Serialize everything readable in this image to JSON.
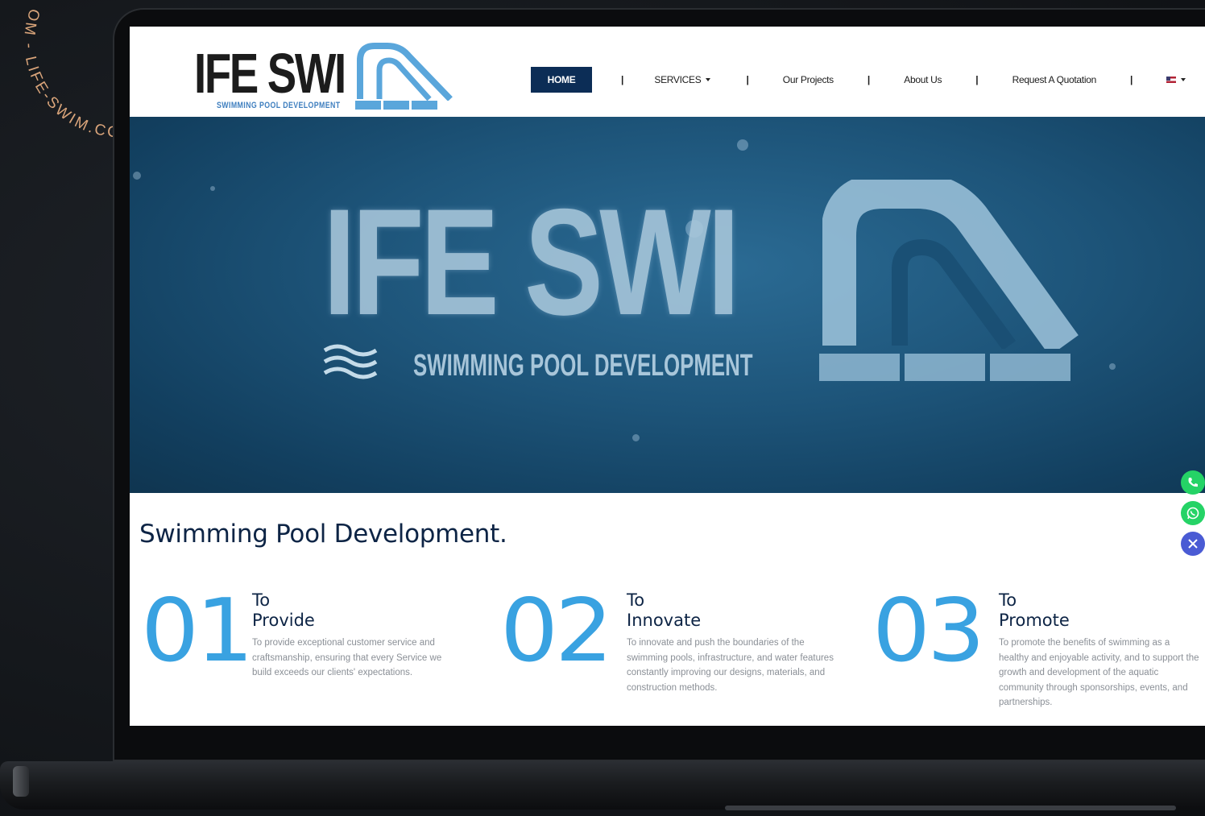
{
  "brand": {
    "name": "LIFE SWIM",
    "logo_text": "IFE SWI",
    "tagline": "SWIMMING POOL DEVELOPMENT"
  },
  "nav": {
    "items": [
      "HOME",
      "SERVICES",
      "Our Projects",
      "About Us",
      "Request A Quotation"
    ],
    "separator": "|",
    "language_icon": "us-flag-icon"
  },
  "hero": {
    "logo_text": "IFE SWI",
    "tagline": "SWIMMING POOL DEVELOPMENT"
  },
  "main": {
    "title": "Swimming Pool Development.",
    "columns": [
      {
        "number": "01",
        "head_line1": "To",
        "head_line2": "Provide",
        "text": "To provide exceptional customer service and craftsmanship, ensuring that every Service we build exceeds our clients' expectations."
      },
      {
        "number": "02",
        "head_line1": "To",
        "head_line2": "Innovate",
        "text": "To innovate and push the boundaries of the swimming pools, infrastructure, and water features constantly improving our designs, materials, and construction methods."
      },
      {
        "number": "03",
        "head_line1": "To",
        "head_line2": "Promote",
        "text": "To promote the benefits of swimming as a healthy and enjoyable activity, and to support the growth and development of the aquatic community through sponsorships, events, and partnerships."
      }
    ]
  },
  "floating_buttons": {
    "icons": [
      "phone-icon",
      "whatsapp-icon",
      "close-icon"
    ],
    "colors": [
      "#25d366",
      "#25d366",
      "#4a5bd4"
    ]
  },
  "stamp": {
    "text": "OM - LIFE-SWIM.COM - LIFE-SWIM.COM",
    "color": "#d9a47a"
  },
  "colors": {
    "nav_active": "#0c2d56",
    "accent": "#2f9ee0",
    "heading": "#0d2445"
  }
}
